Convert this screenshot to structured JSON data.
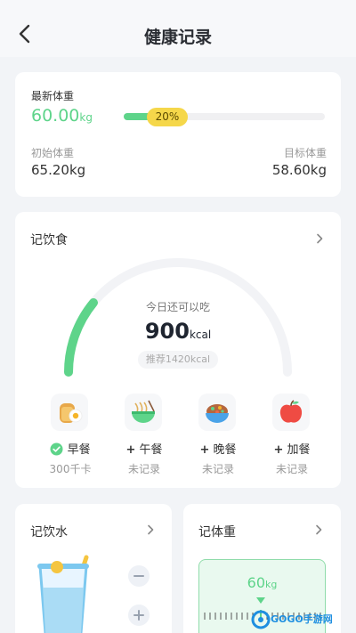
{
  "header": {
    "title": "健康记录"
  },
  "weight": {
    "latest_label": "最新体重",
    "latest_value": "60.00",
    "latest_unit": "kg",
    "progress_text": "20%",
    "progress": 0.2,
    "initial_label": "初始体重",
    "initial_value": "65.20kg",
    "target_label": "目标体重",
    "target_value": "58.60kg"
  },
  "diet": {
    "title": "记饮食",
    "remain_label": "今日还可以吃",
    "remain_value": "900",
    "remain_unit": "kcal",
    "recommend": "推荐1420kcal",
    "meals": [
      {
        "icon": "toast-egg-icon",
        "action": "早餐",
        "status": "300千卡",
        "done": true
      },
      {
        "icon": "noodle-bowl-icon",
        "action": "午餐",
        "status": "未记录",
        "done": false
      },
      {
        "icon": "rice-bowl-icon",
        "action": "晚餐",
        "status": "未记录",
        "done": false
      },
      {
        "icon": "apple-icon",
        "action": "加餐",
        "status": "未记录",
        "done": false
      }
    ]
  },
  "water": {
    "title": "记饮水"
  },
  "scale": {
    "title": "记体重",
    "value": "60",
    "unit": "kg"
  },
  "watermark": {
    "text": "GOGO手游网"
  },
  "colors": {
    "accent": "#5ed48a",
    "badge": "#f5d74a"
  }
}
